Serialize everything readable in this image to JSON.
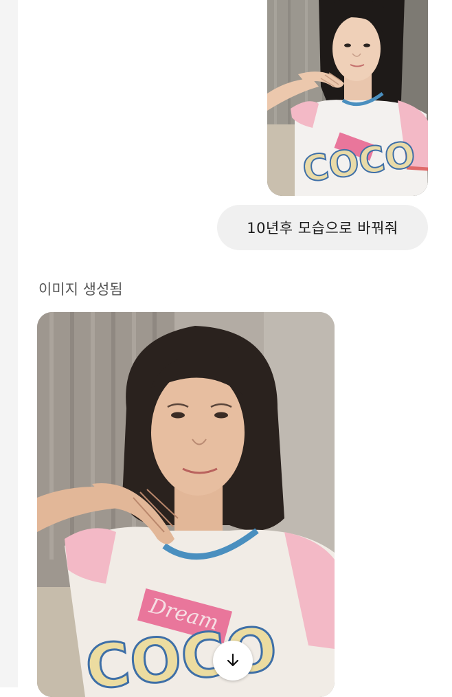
{
  "chat": {
    "user_message": "10년후 모습으로 바꿔줘",
    "status_label": "이미지 생성됨"
  },
  "images": {
    "original_shirt_text": "COCO",
    "generated_shirt_top": "Dream",
    "generated_shirt_main": "COCO"
  },
  "icons": {
    "download": "arrow-down-icon"
  },
  "colors": {
    "bubble_bg": "#f0f0f0",
    "status_text": "#555555",
    "shirt_pink": "#f3b9c6",
    "shirt_trim_blue": "#4a8fbf"
  }
}
